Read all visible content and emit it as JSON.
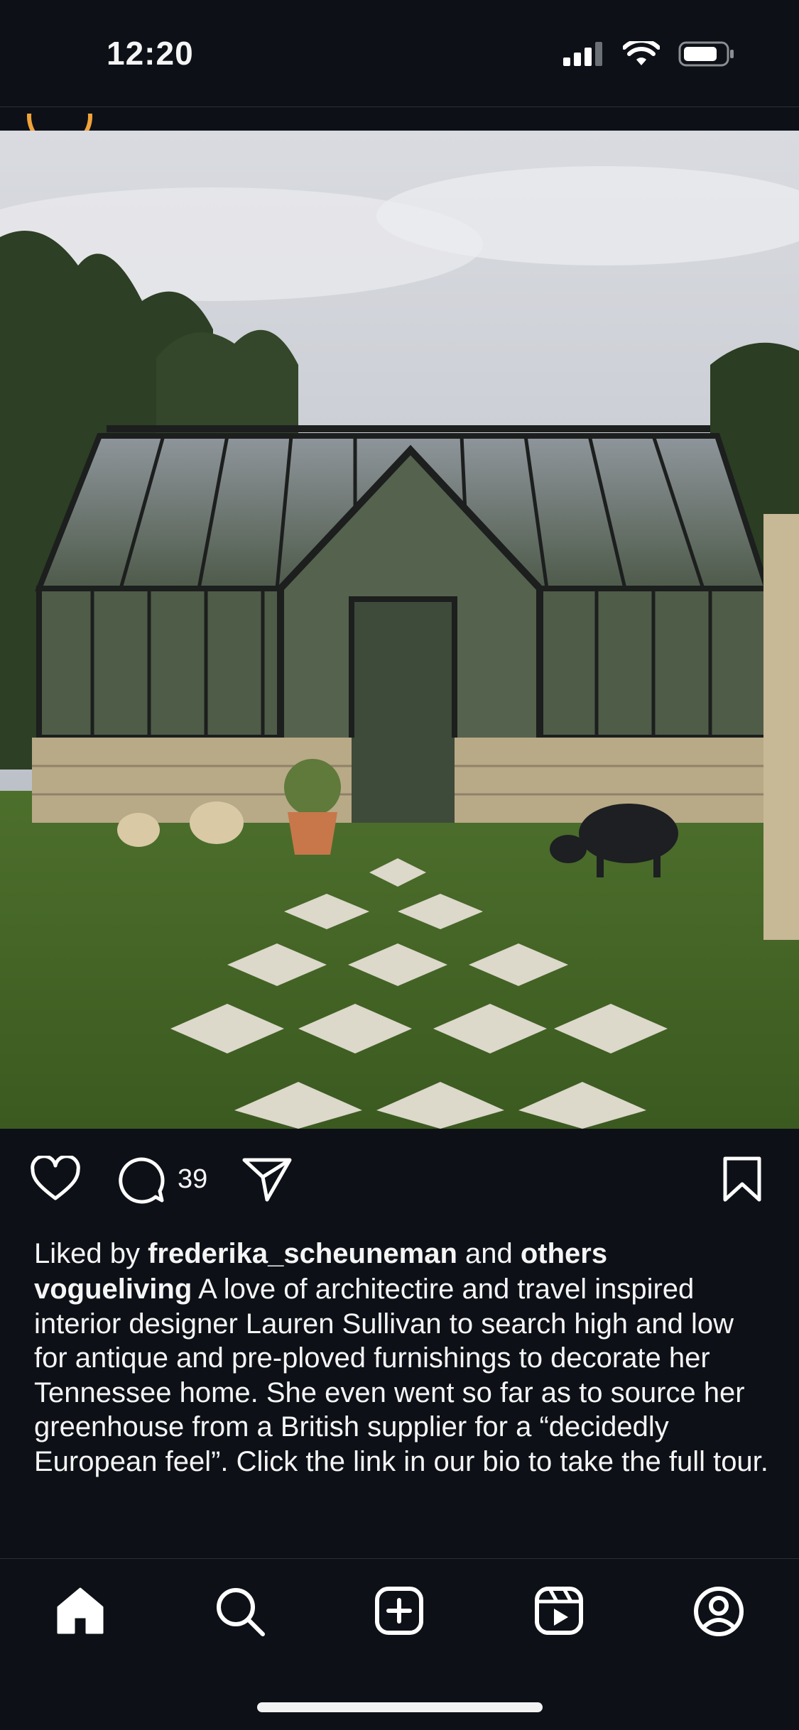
{
  "status_bar": {
    "time": "12:20",
    "icons": [
      "signal-icon",
      "wifi-icon",
      "battery-icon"
    ]
  },
  "post": {
    "image_alt": "Glass greenhouse with checkerboard lawn path",
    "comment_count": "39",
    "liked_by": {
      "prefix": "Liked by ",
      "user": "frederika_scheuneman",
      "middle": " and ",
      "others": "others"
    },
    "caption": {
      "username": "vogueliving",
      "text": " A love of architectire and travel inspired interior designer Lauren Sullivan to search high and low for antique and pre-ploved furnishings to decorate her Tennessee home. She even went so far as to source her greenhouse from a British supplier for a “decidedly European feel”. Click the link in our bio to take the full tour."
    }
  },
  "actions": [
    "heart-icon",
    "comment-icon",
    "share-icon",
    "bookmark-icon"
  ],
  "bottom_nav": [
    "home-icon",
    "search-icon",
    "create-icon",
    "reels-icon",
    "profile-icon"
  ],
  "colors": {
    "background": "#0d1117",
    "text": "#f5f5f5",
    "accent_ring": "#f0a33a"
  }
}
